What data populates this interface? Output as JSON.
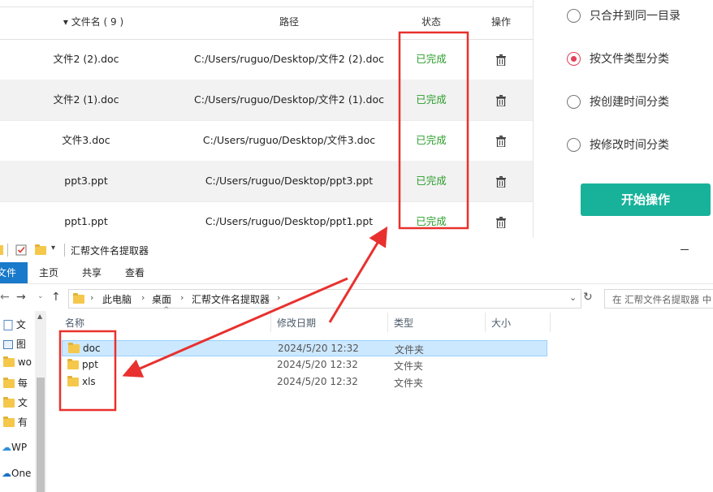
{
  "table": {
    "headers": {
      "name": "▾ 文件名 ( 9 )",
      "path": "路径",
      "status": "状态",
      "op": "操作"
    },
    "rows": [
      {
        "name": "文件2 (2).doc",
        "path": "C:/Users/ruguo/Desktop/文件2 (2).doc",
        "status": "已完成"
      },
      {
        "name": "文件2 (1).doc",
        "path": "C:/Users/ruguo/Desktop/文件2 (1).doc",
        "status": "已完成"
      },
      {
        "name": "文件3.doc",
        "path": "C:/Users/ruguo/Desktop/文件3.doc",
        "status": "已完成"
      },
      {
        "name": "ppt3.ppt",
        "path": "C:/Users/ruguo/Desktop/ppt3.ppt",
        "status": "已完成"
      },
      {
        "name": "ppt1.ppt",
        "path": "C:/Users/ruguo/Desktop/ppt1.ppt",
        "status": "已完成"
      }
    ]
  },
  "options": [
    {
      "label": "只合并到同一目录",
      "selected": false
    },
    {
      "label": "按文件类型分类",
      "selected": true
    },
    {
      "label": "按创建时间分类",
      "selected": false
    },
    {
      "label": "按修改时间分类",
      "selected": false
    }
  ],
  "start_button": "开始操作",
  "explorer": {
    "title": "汇帮文件名提取器",
    "ribbon": {
      "file": "文件",
      "home": "主页",
      "share": "共享",
      "view": "查看"
    },
    "breadcrumb": [
      "此电脑",
      "桌面",
      "汇帮文件名提取器"
    ],
    "search_placeholder": "在 汇帮文件名提取器 中",
    "nav_items": [
      "文",
      "图",
      "wo",
      "每",
      "文",
      "有",
      "WP",
      "One"
    ],
    "columns": {
      "name": "名称",
      "date": "修改日期",
      "type": "类型",
      "size": "大小"
    },
    "files": [
      {
        "name": "doc",
        "date": "2024/5/20 12:32",
        "type": "文件夹"
      },
      {
        "name": "ppt",
        "date": "2024/5/20 12:32",
        "type": "文件夹"
      },
      {
        "name": "xls",
        "date": "2024/5/20 12:32",
        "type": "文件夹"
      }
    ]
  },
  "colors": {
    "status_green": "#2a9d2a",
    "accent_teal": "#18b29a",
    "radio_red": "#e43f5a",
    "annotation_red": "#e8312e",
    "explorer_blue": "#1979ca"
  }
}
